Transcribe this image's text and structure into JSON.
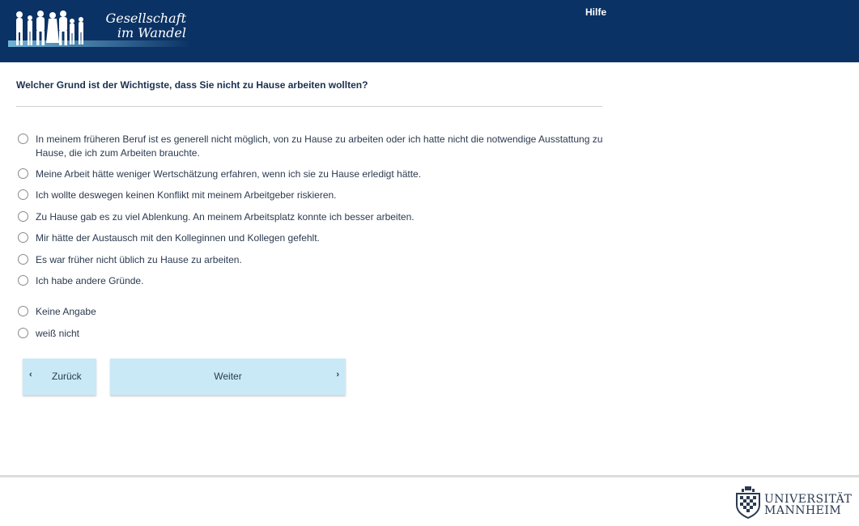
{
  "header": {
    "logo_line1": "Gesellschaft",
    "logo_line2": "im Wandel",
    "help_label": "Hilfe"
  },
  "question": "Welcher Grund ist der Wichtigste, dass Sie nicht zu Hause arbeiten wollten?",
  "options": [
    {
      "label": "In meinem früheren Beruf ist es generell nicht möglich, von zu Hause zu arbeiten oder ich hatte nicht die notwendige Ausstattung zu Hause, die ich zum Arbeiten brauchte.",
      "selected": false
    },
    {
      "label": "Meine Arbeit hätte weniger Wertschätzung erfahren, wenn ich sie zu Hause erledigt hätte.",
      "selected": false
    },
    {
      "label": "Ich wollte deswegen keinen Konflikt mit meinem Arbeitgeber riskieren.",
      "selected": false
    },
    {
      "label": "Zu Hause gab es zu viel Ablenkung. An meinem Arbeitsplatz konnte ich besser arbeiten.",
      "selected": false
    },
    {
      "label": "Mir hätte der Austausch mit den Kolleginnen und Kollegen gefehlt.",
      "selected": false
    },
    {
      "label": "Es war früher nicht üblich zu Hause zu arbeiten.",
      "selected": false
    },
    {
      "label": "Ich habe andere Gründe.",
      "selected": false
    },
    {
      "label": "Keine Angabe",
      "selected": false
    },
    {
      "label": "weiß nicht",
      "selected": false
    }
  ],
  "buttons": {
    "back_label": "Zurück",
    "next_label": "Weiter"
  },
  "footer": {
    "uni_line1": "UNIVERSITÄT",
    "uni_line2": "MANNHEIM"
  },
  "colors": {
    "header_bg": "#0b3264",
    "button_bg": "#c9e9f6"
  }
}
